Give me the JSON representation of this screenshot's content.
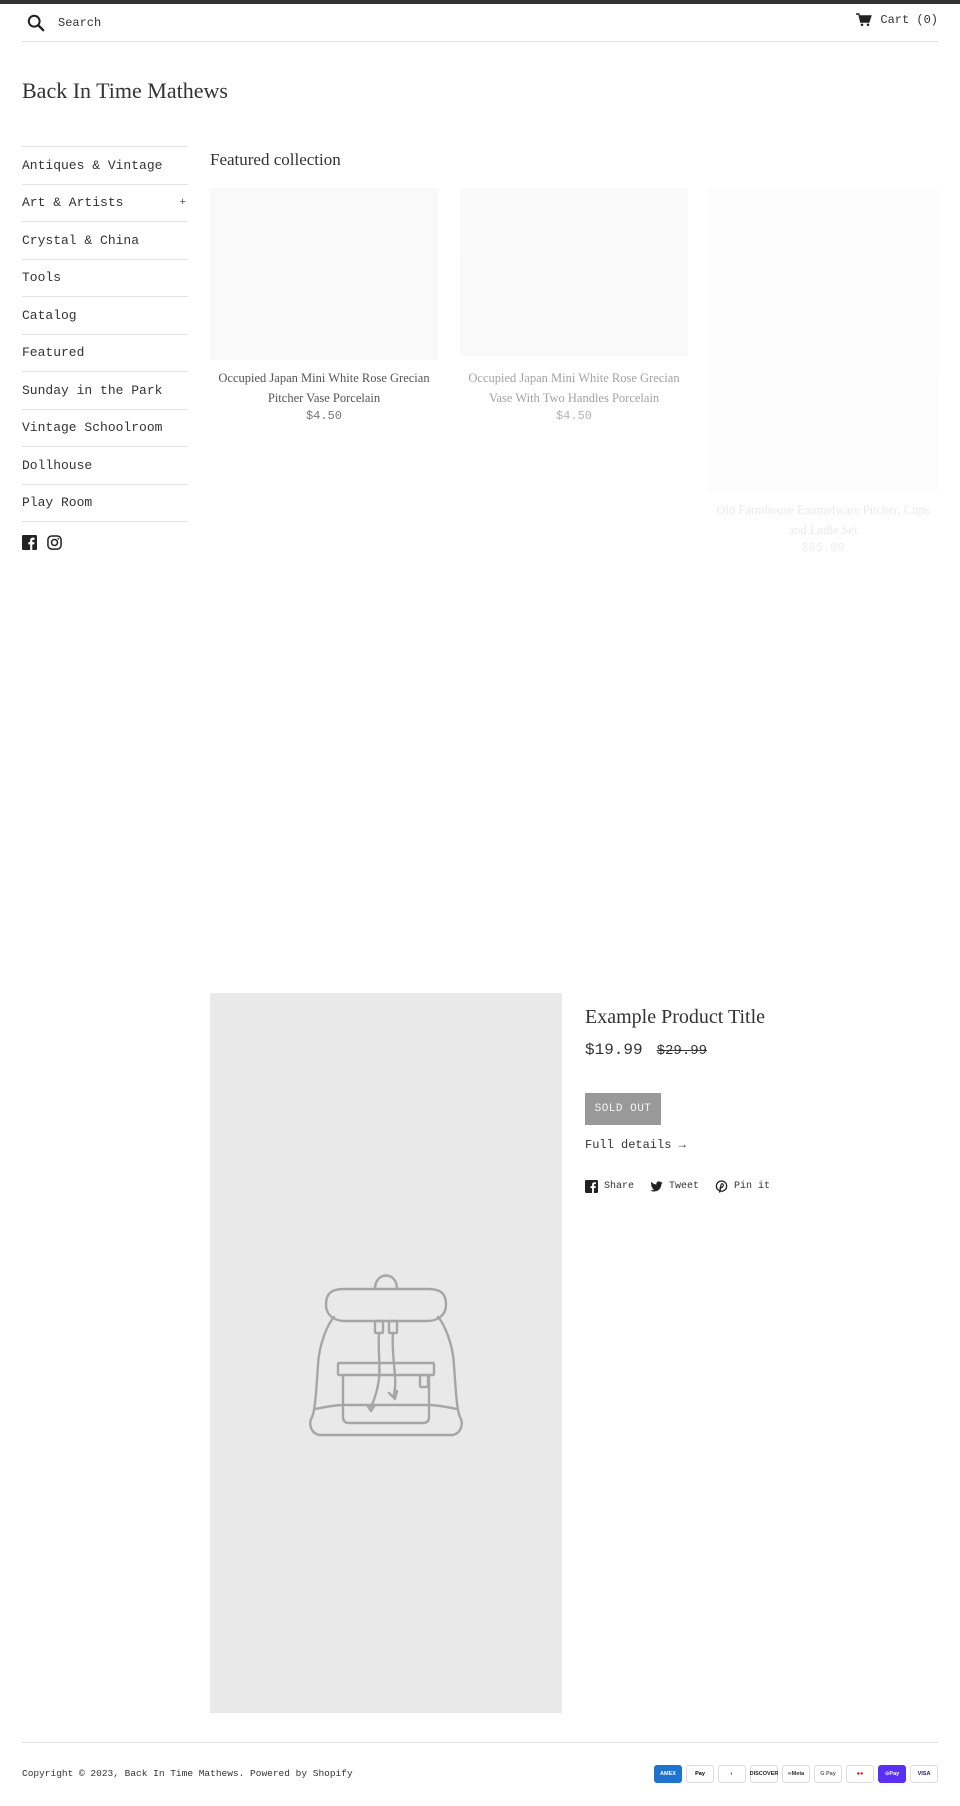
{
  "header": {
    "search_placeholder": "Search",
    "cart_label": "Cart (0)"
  },
  "site": {
    "title": "Back In Time Mathews"
  },
  "sidebar": {
    "items": [
      {
        "label": "Antiques & Vintage",
        "expand": ""
      },
      {
        "label": "Art & Artists",
        "expand": "+"
      },
      {
        "label": "Crystal & China",
        "expand": ""
      },
      {
        "label": "Tools",
        "expand": ""
      },
      {
        "label": "Catalog",
        "expand": ""
      },
      {
        "label": "Featured",
        "expand": ""
      },
      {
        "label": "Sunday in the Park",
        "expand": ""
      },
      {
        "label": "Vintage Schoolroom",
        "expand": ""
      },
      {
        "label": "Dollhouse",
        "expand": ""
      },
      {
        "label": "Play Room",
        "expand": ""
      }
    ],
    "social": [
      "facebook-icon",
      "instagram-icon"
    ]
  },
  "featured": {
    "title": "Featured collection",
    "products": [
      {
        "name": "Occupied Japan Mini White Rose Grecian Pitcher Vase Porcelain",
        "price": "$4.50"
      },
      {
        "name": "Occupied Japan Mini White Rose Grecian Vase With Two Handles Porcelain",
        "price": "$4.50"
      },
      {
        "name": "Old Farmhouse Enamelware Pitcher, Cups and Ladle Set",
        "price": "$65.00"
      }
    ]
  },
  "example_product": {
    "title": "Example Product Title",
    "price": "$19.99",
    "compare_price": "$29.99",
    "button_label": "SOLD OUT",
    "details_link": "Full details →",
    "share": {
      "facebook": "Share",
      "twitter": "Tweet",
      "pinterest": "Pin it"
    }
  },
  "footer": {
    "copyright": "Copyright © 2023, Back In Time Mathews. Powered by Shopify",
    "payments": [
      {
        "name": "american-express-icon",
        "text": "AMEX",
        "bg": "#1f72cd",
        "color": "#ffffff"
      },
      {
        "name": "apple-pay-icon",
        "text": "Pay",
        "bg": "#ffffff",
        "color": "#000000"
      },
      {
        "name": "diners-club-icon",
        "text": "◐",
        "bg": "#ffffff",
        "color": "#0079be"
      },
      {
        "name": "discover-icon",
        "text": "DISCOVER",
        "bg": "#ffffff",
        "color": "#231f20"
      },
      {
        "name": "meta-pay-icon",
        "text": "∞Meta",
        "bg": "#ffffff",
        "color": "#333333"
      },
      {
        "name": "google-pay-icon",
        "text": "G Pay",
        "bg": "#ffffff",
        "color": "#5f6368"
      },
      {
        "name": "mastercard-icon",
        "text": "●●",
        "bg": "#ffffff",
        "color": "#eb001b"
      },
      {
        "name": "shop-pay-icon",
        "text": "⊙Pay",
        "bg": "#5a31f4",
        "color": "#ffffff"
      },
      {
        "name": "visa-icon",
        "text": "VISA",
        "bg": "#ffffff",
        "color": "#1a1f71"
      }
    ]
  }
}
